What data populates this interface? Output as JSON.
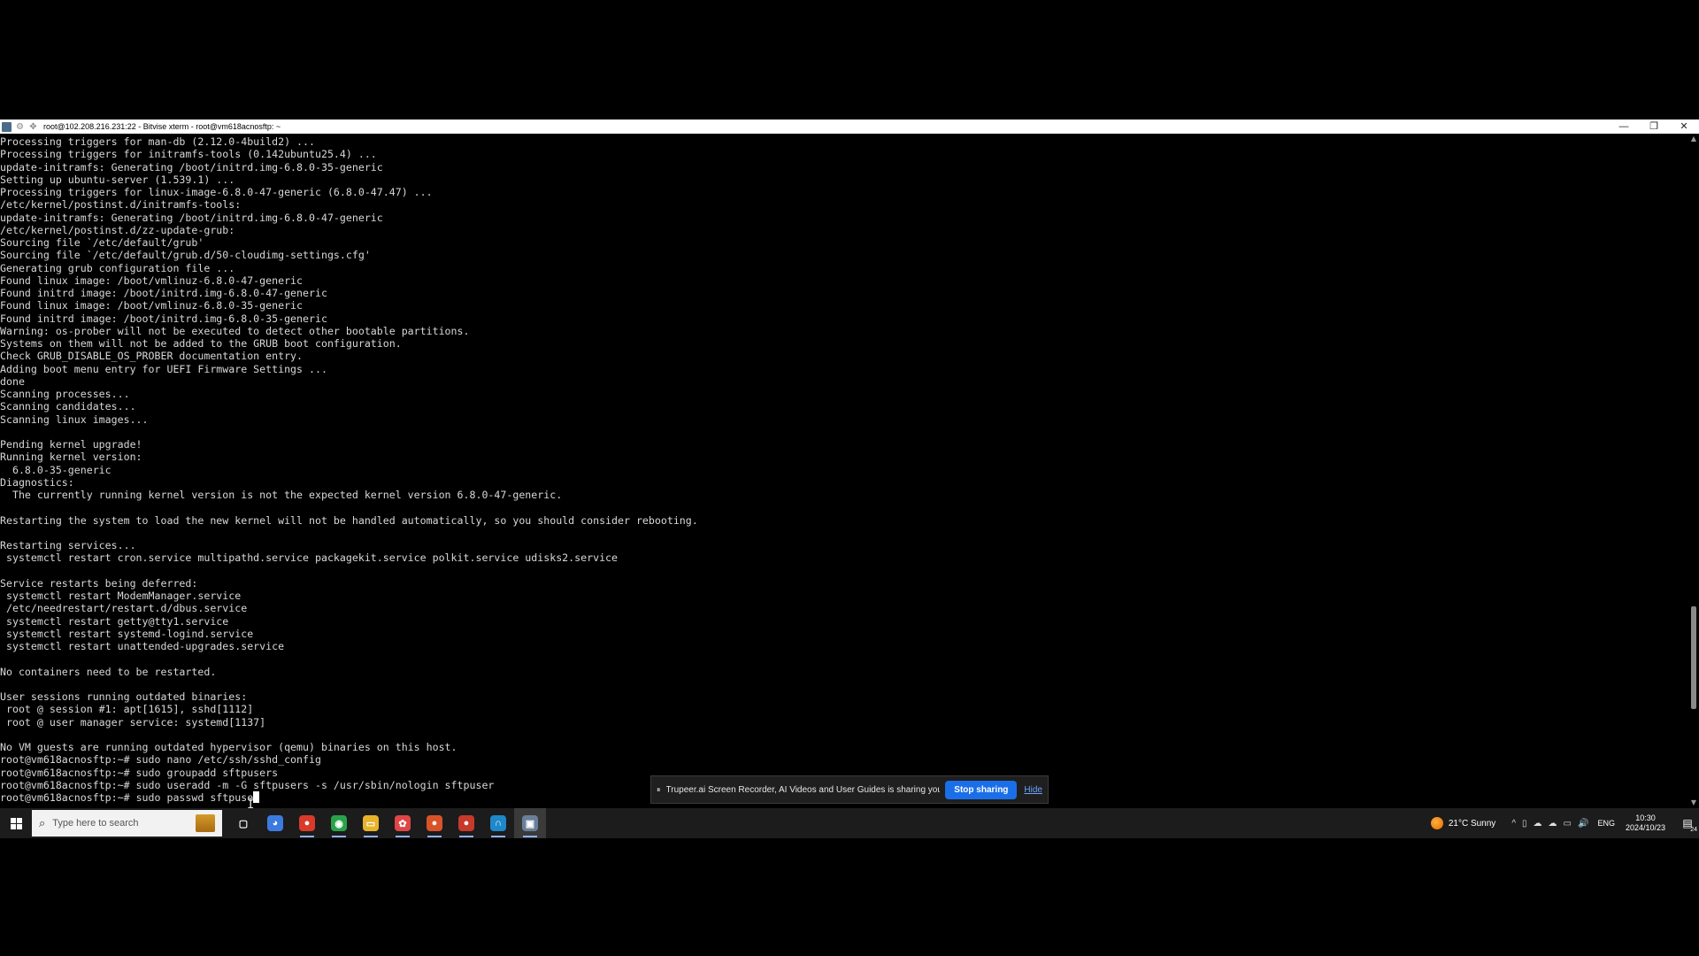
{
  "window": {
    "title": "root@102.208.216.231:22 - Bitvise xterm - root@vm618acnosftp: ~",
    "minimize_glyph": "—",
    "maximize_glyph": "❐",
    "close_glyph": "✕",
    "icons": [
      "app-icon",
      "settings-icon",
      "move-icon"
    ]
  },
  "terminal": {
    "lines": [
      "Processing triggers for man-db (2.12.0-4build2) ...",
      "Processing triggers for initramfs-tools (0.142ubuntu25.4) ...",
      "update-initramfs: Generating /boot/initrd.img-6.8.0-35-generic",
      "Setting up ubuntu-server (1.539.1) ...",
      "Processing triggers for linux-image-6.8.0-47-generic (6.8.0-47.47) ...",
      "/etc/kernel/postinst.d/initramfs-tools:",
      "update-initramfs: Generating /boot/initrd.img-6.8.0-47-generic",
      "/etc/kernel/postinst.d/zz-update-grub:",
      "Sourcing file `/etc/default/grub'",
      "Sourcing file `/etc/default/grub.d/50-cloudimg-settings.cfg'",
      "Generating grub configuration file ...",
      "Found linux image: /boot/vmlinuz-6.8.0-47-generic",
      "Found initrd image: /boot/initrd.img-6.8.0-47-generic",
      "Found linux image: /boot/vmlinuz-6.8.0-35-generic",
      "Found initrd image: /boot/initrd.img-6.8.0-35-generic",
      "Warning: os-prober will not be executed to detect other bootable partitions.",
      "Systems on them will not be added to the GRUB boot configuration.",
      "Check GRUB_DISABLE_OS_PROBER documentation entry.",
      "Adding boot menu entry for UEFI Firmware Settings ...",
      "done",
      "Scanning processes...",
      "Scanning candidates...",
      "Scanning linux images...",
      "",
      "Pending kernel upgrade!",
      "Running kernel version:",
      "  6.8.0-35-generic",
      "Diagnostics:",
      "  The currently running kernel version is not the expected kernel version 6.8.0-47-generic.",
      "",
      "Restarting the system to load the new kernel will not be handled automatically, so you should consider rebooting.",
      "",
      "Restarting services...",
      " systemctl restart cron.service multipathd.service packagekit.service polkit.service udisks2.service",
      "",
      "Service restarts being deferred:",
      " systemctl restart ModemManager.service",
      " /etc/needrestart/restart.d/dbus.service",
      " systemctl restart getty@tty1.service",
      " systemctl restart systemd-logind.service",
      " systemctl restart unattended-upgrades.service",
      "",
      "No containers need to be restarted.",
      "",
      "User sessions running outdated binaries:",
      " root @ session #1: apt[1615], sshd[1112]",
      " root @ user manager service: systemd[1137]",
      "",
      "No VM guests are running outdated hypervisor (qemu) binaries on this host.",
      "root@vm618acnosftp:~# sudo nano /etc/ssh/sshd_config",
      "root@vm618acnosftp:~# sudo groupadd sftpusers",
      "root@vm618acnosftp:~# sudo useradd -m -G sftpusers -s /usr/sbin/nologin sftpuser"
    ],
    "current_prompt": "root@vm618acnosftp:~# ",
    "current_input": "sudo passwd sftpuse"
  },
  "scrollbar": {
    "up_glyph": "▲",
    "down_glyph": "▼",
    "position": 0.84
  },
  "share_banner": {
    "pause_glyph": "⏸",
    "message": "Trupeer.ai Screen Recorder, AI Videos and User Guides is sharing your screen.",
    "stop_label": "Stop sharing",
    "hide_label": "Hide"
  },
  "taskbar": {
    "search_placeholder": "Type here to search",
    "search_glyph": "⌕",
    "apps": [
      {
        "name": "task-view-icon",
        "glyph": "▢",
        "color": "#1c1c1c"
      },
      {
        "name": "copilot-icon",
        "glyph": "◕",
        "color": "#3b7be0"
      },
      {
        "name": "chrome-profile-icon",
        "glyph": "●",
        "color": "#d93a2a"
      },
      {
        "name": "chrome-icon",
        "glyph": "◉",
        "color": "#2aa24a"
      },
      {
        "name": "file-explorer-icon",
        "glyph": "▭",
        "color": "#e8b32a"
      },
      {
        "name": "app-red-icon",
        "glyph": "✿",
        "color": "#e04646"
      },
      {
        "name": "chrome-profile-2-icon",
        "glyph": "●",
        "color": "#d9532a"
      },
      {
        "name": "chrome-profile-3-icon",
        "glyph": "●",
        "color": "#c7392a"
      },
      {
        "name": "bitvise-client-icon",
        "glyph": "∩",
        "color": "#1e88c8"
      },
      {
        "name": "bitvise-xterm-icon",
        "glyph": "▣",
        "color": "#6a7f99"
      }
    ],
    "weather": "21°C  Sunny",
    "tray_glyphs": [
      "^",
      "▯",
      "☁",
      "☁",
      "▭",
      "🔊"
    ],
    "language": "ENG",
    "time": "10:30",
    "date": "2024/10/23",
    "notification_glyph": "▤",
    "notification_count": "24"
  }
}
